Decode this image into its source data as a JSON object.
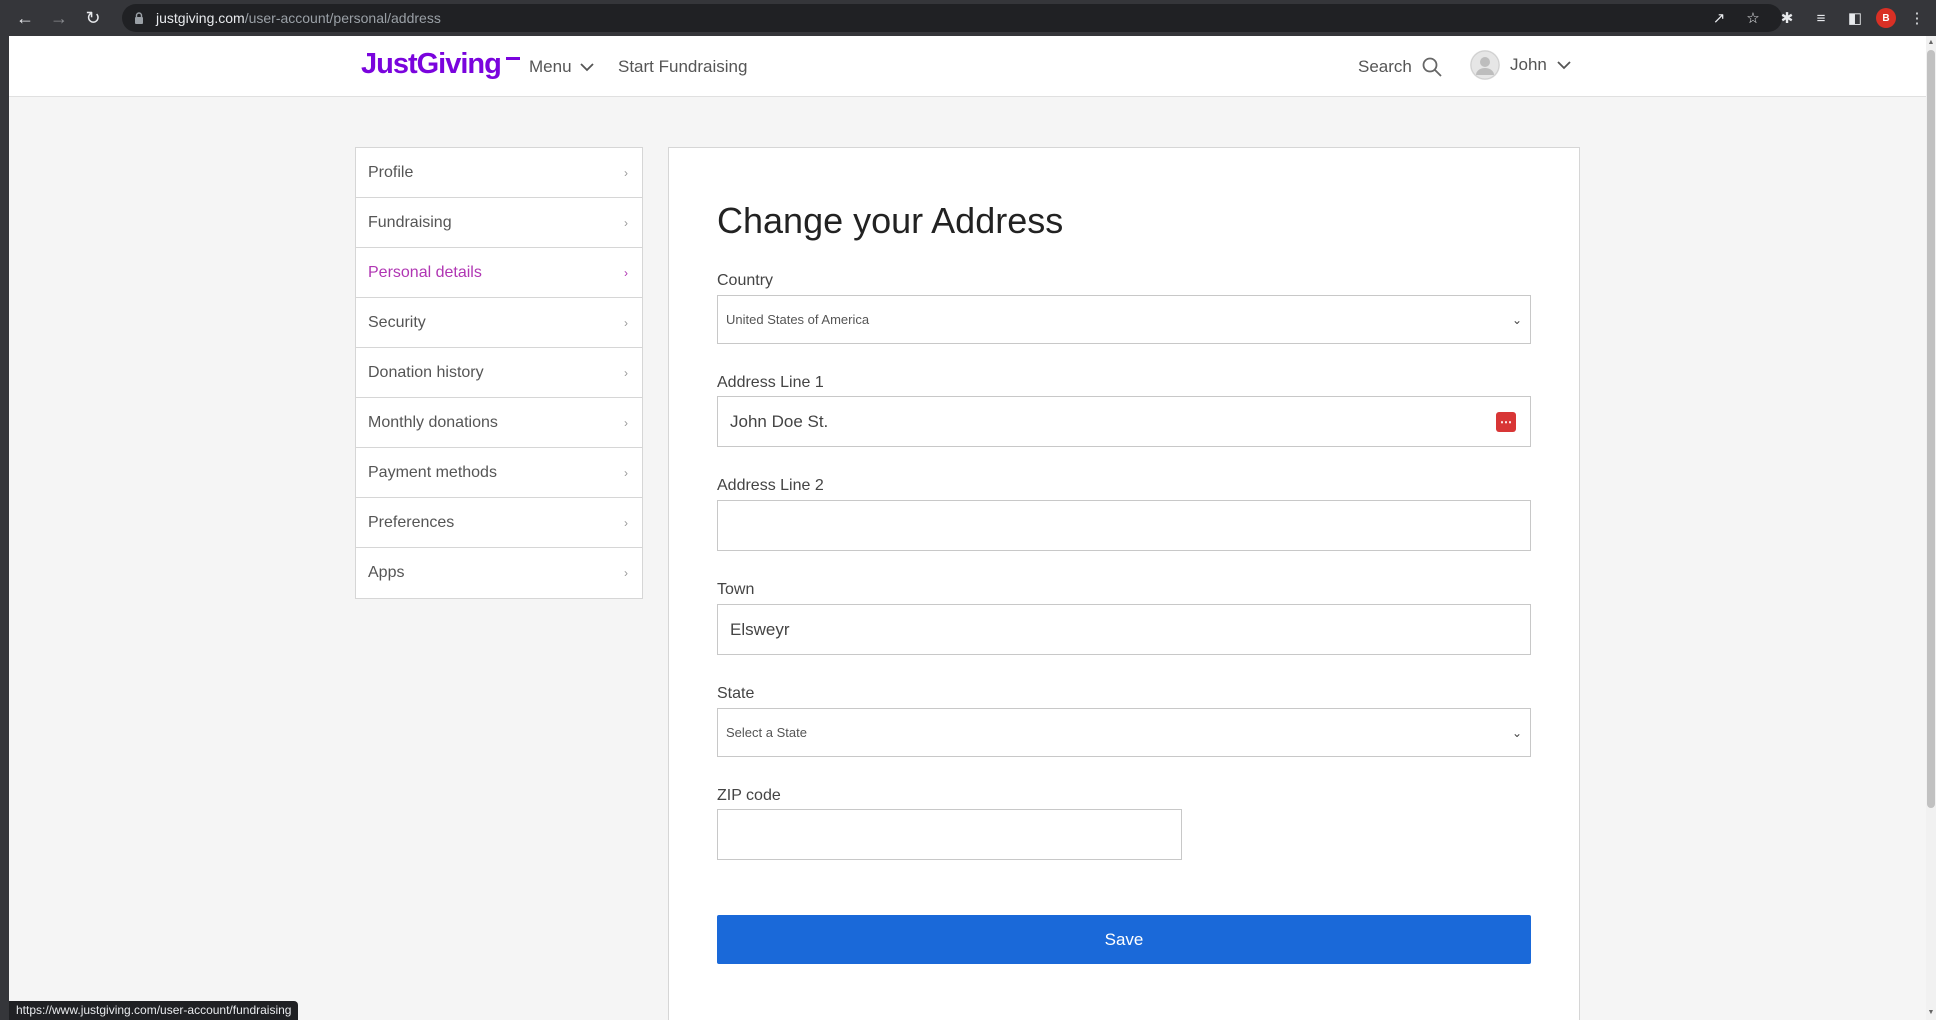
{
  "browser": {
    "url_host": "justgiving.com",
    "url_path": "/user-account/personal/address",
    "profile_initial": "B",
    "status_url": "https://www.justgiving.com/user-account/fundraising"
  },
  "header": {
    "logo": "JustGiving",
    "menu_label": "Menu",
    "start_label": "Start Fundraising",
    "search_label": "Search",
    "user_name": "John"
  },
  "sidenav": {
    "items": [
      {
        "label": "Profile",
        "active": false
      },
      {
        "label": "Fundraising",
        "active": false
      },
      {
        "label": "Personal details",
        "active": true
      },
      {
        "label": "Security",
        "active": false
      },
      {
        "label": "Donation history",
        "active": false
      },
      {
        "label": "Monthly donations",
        "active": false
      },
      {
        "label": "Payment methods",
        "active": false
      },
      {
        "label": "Preferences",
        "active": false
      },
      {
        "label": "Apps",
        "active": false
      }
    ]
  },
  "form": {
    "title": "Change your Address",
    "country_label": "Country",
    "country_value": "United States of America",
    "address1_label": "Address Line 1",
    "address1_value": "John Doe St.",
    "address2_label": "Address Line 2",
    "address2_value": "",
    "town_label": "Town",
    "town_value": "Elsweyr",
    "state_label": "State",
    "state_value": "Select a State",
    "zip_label": "ZIP code",
    "zip_value": "",
    "save_label": "Save"
  },
  "colors": {
    "brand": "#7a04dd",
    "active_nav": "#b036b3",
    "save_button": "#1a69d9"
  }
}
